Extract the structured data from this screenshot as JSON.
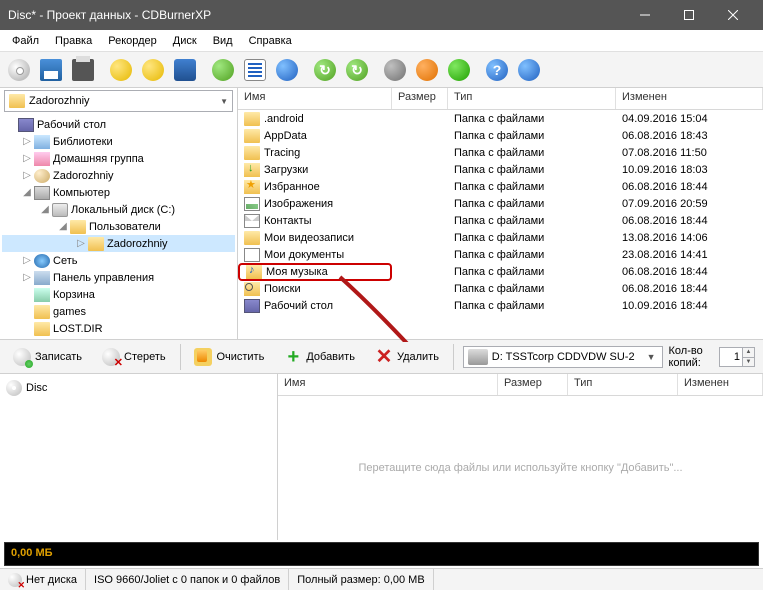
{
  "window": {
    "title": "Disc* - Проект данных - CDBurnerXP"
  },
  "menu": {
    "file": "Файл",
    "edit": "Правка",
    "recorder": "Рекордер",
    "disc": "Диск",
    "view": "Вид",
    "help": "Справка"
  },
  "path": {
    "current": "Zadorozhniy"
  },
  "tree": [
    {
      "ind": 0,
      "tw": "",
      "ico": "ico-desktop",
      "label": "Рабочий стол"
    },
    {
      "ind": 1,
      "tw": "▷",
      "ico": "ico-lib",
      "label": "Библиотеки"
    },
    {
      "ind": 1,
      "tw": "▷",
      "ico": "ico-home",
      "label": "Домашняя группа"
    },
    {
      "ind": 1,
      "tw": "▷",
      "ico": "ico-user",
      "label": "Zadorozhniy"
    },
    {
      "ind": 1,
      "tw": "◢",
      "ico": "ico-comp",
      "label": "Компьютер"
    },
    {
      "ind": 2,
      "tw": "◢",
      "ico": "ico-drive",
      "label": "Локальный диск (C:)"
    },
    {
      "ind": 3,
      "tw": "◢",
      "ico": "ico-folder",
      "label": "Пользователи"
    },
    {
      "ind": 4,
      "tw": "▷",
      "ico": "ico-folder",
      "label": "Zadorozhniy",
      "sel": true
    },
    {
      "ind": 1,
      "tw": "▷",
      "ico": "ico-network",
      "label": "Сеть"
    },
    {
      "ind": 1,
      "tw": "▷",
      "ico": "ico-panel",
      "label": "Панель управления"
    },
    {
      "ind": 1,
      "tw": "",
      "ico": "ico-recycle",
      "label": "Корзина"
    },
    {
      "ind": 1,
      "tw": "",
      "ico": "ico-folder",
      "label": "games"
    },
    {
      "ind": 1,
      "tw": "",
      "ico": "ico-folder",
      "label": "LOST.DIR"
    }
  ],
  "cols": {
    "name": "Имя",
    "size": "Размер",
    "type": "Тип",
    "mod": "Изменен"
  },
  "files": [
    {
      "ico": "ico-folder",
      "name": ".android",
      "type": "Папка с файлами",
      "mod": "04.09.2016 15:04"
    },
    {
      "ico": "ico-folder",
      "name": "AppData",
      "type": "Папка с файлами",
      "mod": "06.08.2016 18:43"
    },
    {
      "ico": "ico-folder",
      "name": "Tracing",
      "type": "Папка с файлами",
      "mod": "07.08.2016 11:50"
    },
    {
      "ico": "ico-dl",
      "name": "Загрузки",
      "type": "Папка с файлами",
      "mod": "10.09.2016 18:03"
    },
    {
      "ico": "ico-fav",
      "name": "Избранное",
      "type": "Папка с файлами",
      "mod": "06.08.2016 18:44"
    },
    {
      "ico": "ico-img",
      "name": "Изображения",
      "type": "Папка с файлами",
      "mod": "07.09.2016 20:59"
    },
    {
      "ico": "ico-mail",
      "name": "Контакты",
      "type": "Папка с файлами",
      "mod": "06.08.2016 18:44"
    },
    {
      "ico": "ico-folder",
      "name": "Мои видеозаписи",
      "type": "Папка с файлами",
      "mod": "13.08.2016 14:06"
    },
    {
      "ico": "ico-doc",
      "name": "Мои документы",
      "type": "Папка с файлами",
      "mod": "23.08.2016 14:41"
    },
    {
      "ico": "ico-music",
      "name": "Моя музыка",
      "type": "Папка с файлами",
      "mod": "06.08.2016 18:44",
      "hl": true
    },
    {
      "ico": "ico-search",
      "name": "Поиски",
      "type": "Папка с файлами",
      "mod": "06.08.2016 18:44"
    },
    {
      "ico": "ico-desktop",
      "name": "Рабочий стол",
      "type": "Папка с файлами",
      "mod": "10.09.2016 18:44"
    }
  ],
  "actions": {
    "burn": "Записать",
    "erase": "Стереть",
    "clear": "Очистить",
    "add": "Добавить",
    "del": "Удалить"
  },
  "drive": "D: TSSTcorp CDDVDW SU-2",
  "copies": {
    "label": "Кол-во копий:",
    "value": "1"
  },
  "comp": {
    "disc": "Disc",
    "placeholder": "Перетащите сюда файлы или используйте кнопку \"Добавить\"..."
  },
  "progress": "0,00 МБ",
  "status": {
    "nodisc": "Нет диска",
    "iso": "ISO 9660/Joliet с 0 папок и 0 файлов",
    "size": "Полный размер: 0,00 MB"
  }
}
